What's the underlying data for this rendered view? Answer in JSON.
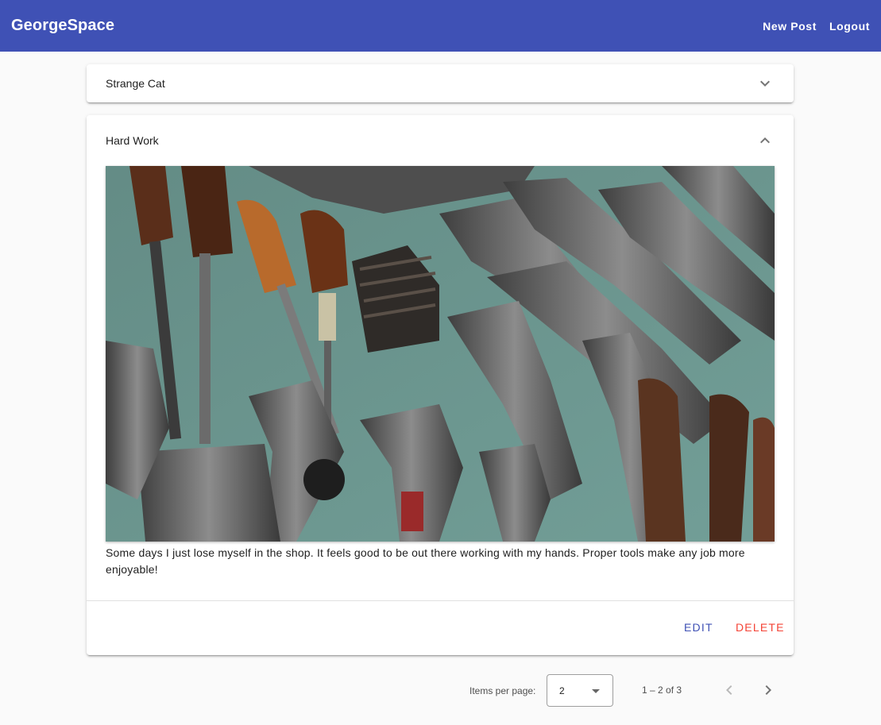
{
  "app": {
    "brand": "GeorgeSpace",
    "nav": {
      "new_post": "New Post",
      "logout": "Logout"
    }
  },
  "posts": [
    {
      "title": "Strange Cat",
      "expanded": false,
      "chevron_icon": "chevron-down-icon"
    },
    {
      "title": "Hard Work",
      "expanded": true,
      "chevron_icon": "chevron-up-icon",
      "image_subject": "rusty-hand-tools-photo",
      "body": "Some days I just lose myself in the shop. It feels good to be out there working with my hands. Proper tools make any job more enjoyable!",
      "actions": {
        "edit": "Edit",
        "delete": "Delete"
      }
    }
  ],
  "paginator": {
    "items_per_page_label": "Items per page:",
    "page_size": "2",
    "range_label": "1 – 2 of 3",
    "prev_icon": "chevron-left-icon",
    "next_icon": "chevron-right-icon",
    "prev_disabled": true,
    "next_disabled": false
  },
  "colors": {
    "primary": "#3f51b5",
    "warn": "#f44336"
  }
}
